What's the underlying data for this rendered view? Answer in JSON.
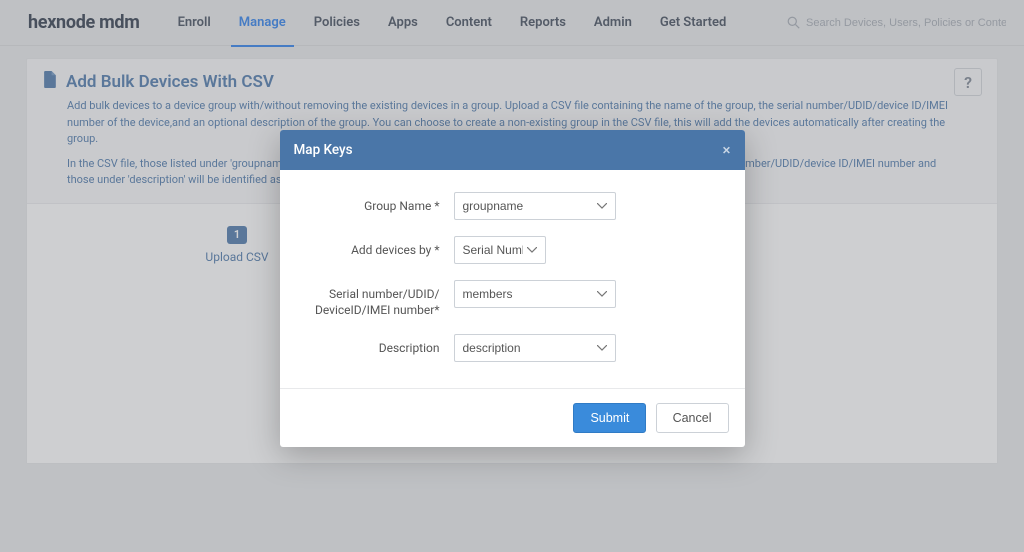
{
  "brand": "hexnode mdm",
  "nav": {
    "items": [
      "Enroll",
      "Manage",
      "Policies",
      "Apps",
      "Content",
      "Reports",
      "Admin",
      "Get Started"
    ],
    "active_index": 1
  },
  "search": {
    "placeholder": "Search Devices, Users, Policies or Content"
  },
  "page": {
    "title": "Add Bulk Devices With CSV",
    "help": "?",
    "desc1": "Add bulk devices to a device group with/without removing the existing devices in a group. Upload a CSV file containing the name of the group, the serial number/UDID/device ID/IMEI number of the device,and an optional description of the group. You can choose to create a non-existing group in the CSV file, this will add the devices automatically after creating the group.",
    "desc2": "In the CSV file, those listed under 'groupname' will be identified as the group names, those under 'members' will be identified as the serial number/UDID/device ID/IMEI number and those under 'description' will be identified as the description."
  },
  "steps": {
    "step1_number": "1",
    "step1_label": "Upload CSV"
  },
  "modal": {
    "title": "Map Keys",
    "labels": {
      "group_name": "Group Name *",
      "add_devices_by": "Add devices by *",
      "serial": "Serial number/UDID/ DeviceID/IMEI number*",
      "description": "Description"
    },
    "values": {
      "group_name": "groupname",
      "add_devices_by": "Serial Number",
      "serial": "members",
      "description": "description"
    },
    "submit": "Submit",
    "cancel": "Cancel"
  }
}
